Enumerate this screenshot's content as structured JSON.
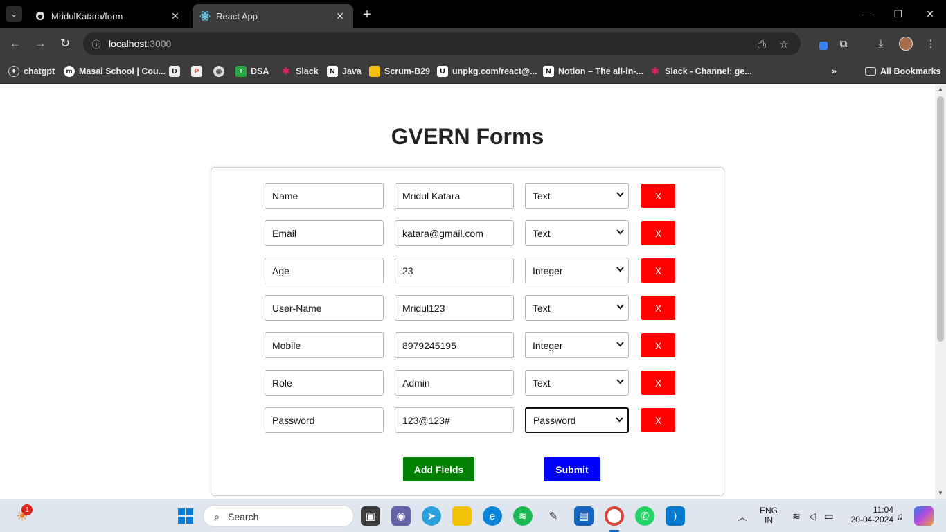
{
  "browser": {
    "tabs": [
      {
        "title": "MridulKatara/form",
        "favicon": "github-icon",
        "active": false
      },
      {
        "title": "React App",
        "favicon": "react-icon",
        "active": true
      }
    ],
    "url_host": "localhost",
    "url_port": ":3000",
    "bookmarks": [
      {
        "label": "chatgpt",
        "icon": "openai-icon"
      },
      {
        "label": "Masai School | Cou...",
        "icon": "masai-icon"
      },
      {
        "label": "",
        "icon": "d-icon"
      },
      {
        "label": "",
        "icon": "pg-icon"
      },
      {
        "label": "",
        "icon": "circle-icon"
      },
      {
        "label": "DSA",
        "icon": "plus-green-icon"
      },
      {
        "label": "Slack",
        "icon": "slack-icon"
      },
      {
        "label": "Java",
        "icon": "notion-icon"
      },
      {
        "label": "Scrum-B29",
        "icon": "folder-yellow-icon"
      },
      {
        "label": "unpkg.com/react@...",
        "icon": "unpkg-icon"
      },
      {
        "label": "Notion – The all-in-...",
        "icon": "notion-icon"
      },
      {
        "label": "Slack - Channel: ge...",
        "icon": "slack-icon"
      }
    ],
    "all_bookmarks": "All Bookmarks"
  },
  "page": {
    "title": "GVERN Forms",
    "fields": [
      {
        "name": "Name",
        "value": "Mridul Katara",
        "type": "Text",
        "remove": "X"
      },
      {
        "name": "Email",
        "value": "katara@gmail.com",
        "type": "Text",
        "remove": "X"
      },
      {
        "name": "Age",
        "value": "23",
        "type": "Integer",
        "remove": "X"
      },
      {
        "name": "User-Name",
        "value": "Mridul123",
        "type": "Text",
        "remove": "X"
      },
      {
        "name": "Mobile",
        "value": "8979245195",
        "type": "Integer",
        "remove": "X"
      },
      {
        "name": "Role",
        "value": "Admin",
        "type": "Text",
        "remove": "X"
      },
      {
        "name": "Password",
        "value": "123@123#",
        "type": "Password",
        "remove": "X"
      }
    ],
    "add_label": "Add Fields",
    "submit_label": "Submit",
    "colors": {
      "remove": "#ff0000",
      "add": "#008000",
      "submit": "#0000ff"
    }
  },
  "taskbar": {
    "search_placeholder": "Search",
    "notification_count": "1",
    "lang_top": "ENG",
    "lang_bottom": "IN",
    "time": "11:04",
    "date": "20-04-2024"
  }
}
